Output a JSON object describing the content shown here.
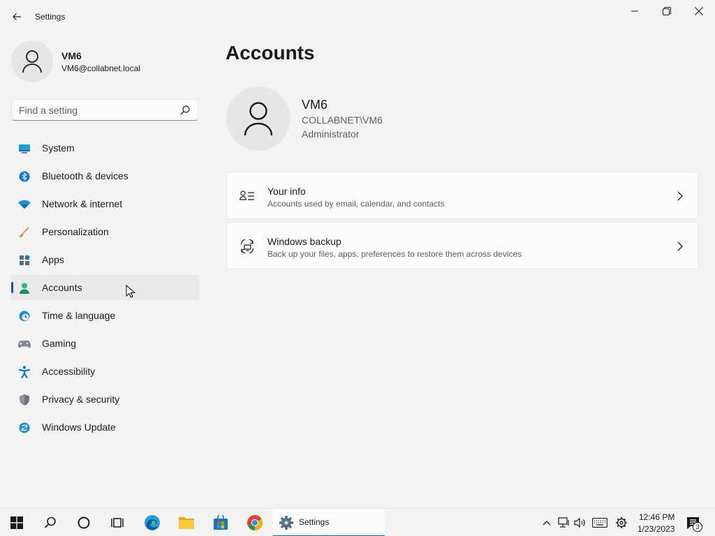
{
  "window": {
    "title": "Settings"
  },
  "profile": {
    "name": "VM6",
    "email": "VM6@collabnet.local"
  },
  "search": {
    "placeholder": "Find a setting"
  },
  "nav": {
    "items": [
      {
        "label": "System",
        "icon": "system-icon"
      },
      {
        "label": "Bluetooth & devices",
        "icon": "bluetooth-icon"
      },
      {
        "label": "Network & internet",
        "icon": "wifi-icon"
      },
      {
        "label": "Personalization",
        "icon": "brush-icon"
      },
      {
        "label": "Apps",
        "icon": "apps-icon"
      },
      {
        "label": "Accounts",
        "icon": "accounts-icon",
        "active": true
      },
      {
        "label": "Time & language",
        "icon": "clock-globe-icon"
      },
      {
        "label": "Gaming",
        "icon": "gamepad-icon"
      },
      {
        "label": "Accessibility",
        "icon": "accessibility-icon"
      },
      {
        "label": "Privacy & security",
        "icon": "shield-icon"
      },
      {
        "label": "Windows Update",
        "icon": "update-icon"
      }
    ]
  },
  "main": {
    "title": "Accounts",
    "account": {
      "name": "VM6",
      "domain": "COLLABNET\\VM6",
      "role": "Administrator"
    },
    "cards": [
      {
        "title": "Your info",
        "subtitle": "Accounts used by email, calendar, and contacts",
        "icon": "contact-card-icon"
      },
      {
        "title": "Windows backup",
        "subtitle": "Back up your files, apps, preferences to restore them across devices",
        "icon": "backup-icon"
      }
    ]
  },
  "taskbar": {
    "active_app_label": "Settings",
    "time": "12:46 PM",
    "date": "1/23/2023",
    "notification_count": "3"
  },
  "colors": {
    "accent": "#005fb8",
    "background": "#f3f3f3",
    "card": "#fbfbfb"
  }
}
